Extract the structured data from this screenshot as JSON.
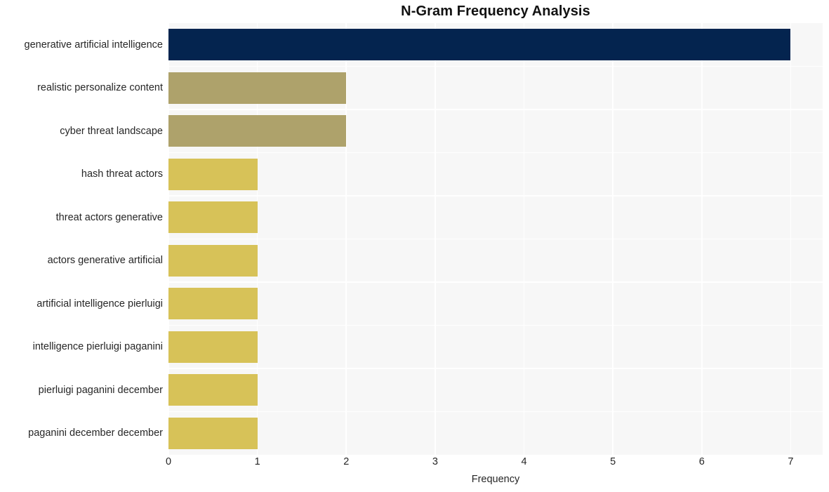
{
  "chart_data": {
    "type": "bar",
    "orientation": "horizontal",
    "title": "N-Gram Frequency Analysis",
    "xlabel": "Frequency",
    "ylabel": "",
    "xlim": [
      0,
      7.36
    ],
    "xticks": [
      "0",
      "1",
      "2",
      "3",
      "4",
      "5",
      "6",
      "7"
    ],
    "xtick_values": [
      0,
      1,
      2,
      3,
      4,
      5,
      6,
      7
    ],
    "grid": true,
    "legend": null,
    "categories": [
      "generative artificial intelligence",
      "realistic personalize content",
      "cyber threat landscape",
      "hash threat actors",
      "threat actors generative",
      "actors generative artificial",
      "artificial intelligence pierluigi",
      "intelligence pierluigi paganini",
      "pierluigi paganini december",
      "paganini december december"
    ],
    "values": [
      7,
      2,
      2,
      1,
      1,
      1,
      1,
      1,
      1,
      1
    ],
    "bar_colors": [
      "#04244f",
      "#aea26b",
      "#aea26b",
      "#d7c258",
      "#d7c258",
      "#d7c258",
      "#d7c258",
      "#d7c258",
      "#d7c258",
      "#d7c258"
    ],
    "plot_background": "#f7f7f7",
    "grid_color": "#ffffff",
    "figure_background": "#ffffff"
  }
}
